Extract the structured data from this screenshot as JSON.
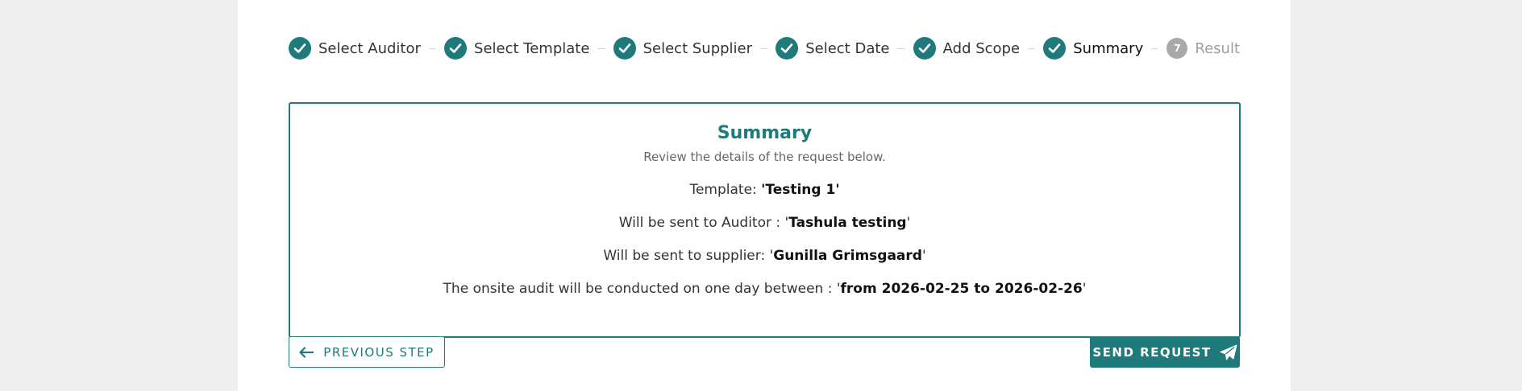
{
  "stepper": {
    "steps": [
      {
        "label": "Select Auditor",
        "state": "done"
      },
      {
        "label": "Select Template",
        "state": "done"
      },
      {
        "label": "Select Supplier",
        "state": "done"
      },
      {
        "label": "Select Date",
        "state": "done"
      },
      {
        "label": "Add Scope",
        "state": "done"
      },
      {
        "label": "Summary",
        "state": "active"
      },
      {
        "label": "Result",
        "state": "pending",
        "number": "7"
      }
    ]
  },
  "summary": {
    "title": "Summary",
    "subtitle": "Review the details of the request below.",
    "template_prefix": "Template: ",
    "template_value": "'Testing 1'",
    "auditor_prefix": "Will be sent to Auditor : '",
    "auditor_value": "Tashula testing",
    "auditor_suffix": "'",
    "supplier_prefix": "Will be sent to supplier: '",
    "supplier_value": "Gunilla Grimsgaard",
    "supplier_suffix": "'",
    "date_prefix": "The onsite audit will be conducted on one day between : '",
    "date_value": "from 2026-02-25 to 2026-02-26",
    "date_suffix": "'"
  },
  "buttons": {
    "previous_label": "PREVIOUS STEP",
    "previous_icon": "arrow-left-icon",
    "send_label": "SEND REQUEST",
    "send_icon": "paper-plane-icon"
  },
  "colors": {
    "accent": "#1f7a7c",
    "pending": "#a9a9a9",
    "background": "#eeeeee"
  }
}
